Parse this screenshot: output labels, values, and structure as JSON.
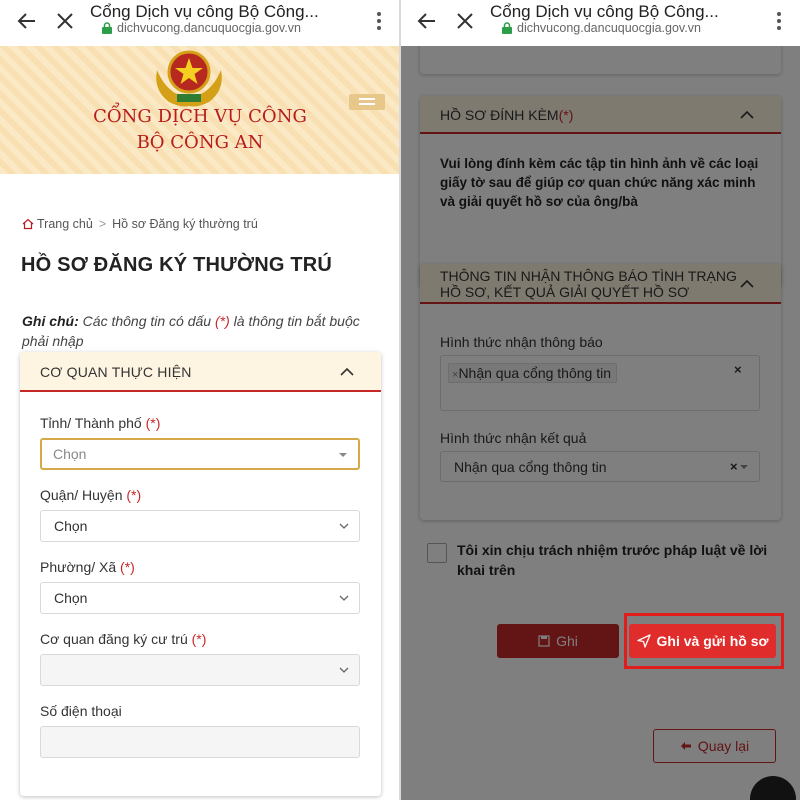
{
  "browser": {
    "title": "Cổng Dịch vụ công Bộ Công...",
    "url": "dichvucong.dancuquocgia.gov.vn"
  },
  "banner": {
    "line1": "CỔNG DỊCH VỤ CÔNG",
    "line2": "BỘ CÔNG AN"
  },
  "breadcrumb": {
    "home": "Trang chủ",
    "separator": ">",
    "current": "Hồ sơ Đăng ký thường trú"
  },
  "page_title": "HỒ SƠ ĐĂNG KÝ THƯỜNG TRÚ",
  "note": {
    "label": "Ghi chú:",
    "text_before": " Các thông tin có dấu ",
    "required_mark": "(*)",
    "text_after": " là thông tin bắt buộc phải nhập"
  },
  "agency_section": {
    "header": "CƠ QUAN THỰC HIỆN",
    "fields": [
      {
        "label": "Tỉnh/ Thành phố",
        "required": "(*)",
        "value": "Chọn"
      },
      {
        "label": "Quận/ Huyện",
        "required": "(*)",
        "value": "Chọn"
      },
      {
        "label": "Phường/ Xã",
        "required": "(*)",
        "value": "Chọn"
      },
      {
        "label": "Cơ quan đăng ký cư trú",
        "required": "(*)",
        "value": ""
      },
      {
        "label": "Số điện thoại",
        "required": "",
        "value": ""
      }
    ]
  },
  "attachments_section": {
    "header": "HỒ SƠ ĐÍNH KÈM",
    "required": "(*)",
    "text": "Vui lòng đính kèm các tập tin hình ảnh về các loại giấy tờ sau để giúp cơ quan chức năng xác minh và giải quyết hồ sơ của ông/bà"
  },
  "notification_section": {
    "header_line1": "THÔNG TIN NHẬN THÔNG BÁO TÌNH TRẠNG",
    "header_line2": "HỒ SƠ, KẾT QUẢ GIẢI QUYẾT HỒ SƠ",
    "notify_label": "Hình thức nhận thông báo",
    "notify_tag": "Nhận qua cổng thông tin",
    "result_label": "Hình thức nhận kết quả",
    "result_value": "Nhận qua cổng thông tin"
  },
  "agree_text": "Tôi xin chịu trách nhiệm trước pháp luật về lời khai trên",
  "buttons": {
    "save": "Ghi",
    "submit": "Ghi và gửi hồ sơ",
    "back": "Quay lại"
  },
  "colors": {
    "brand_red": "#c62828",
    "highlight_red": "#e21b1b",
    "banner_bg": "#fbe9c6",
    "section_head_bg": "#fdf5e1"
  }
}
